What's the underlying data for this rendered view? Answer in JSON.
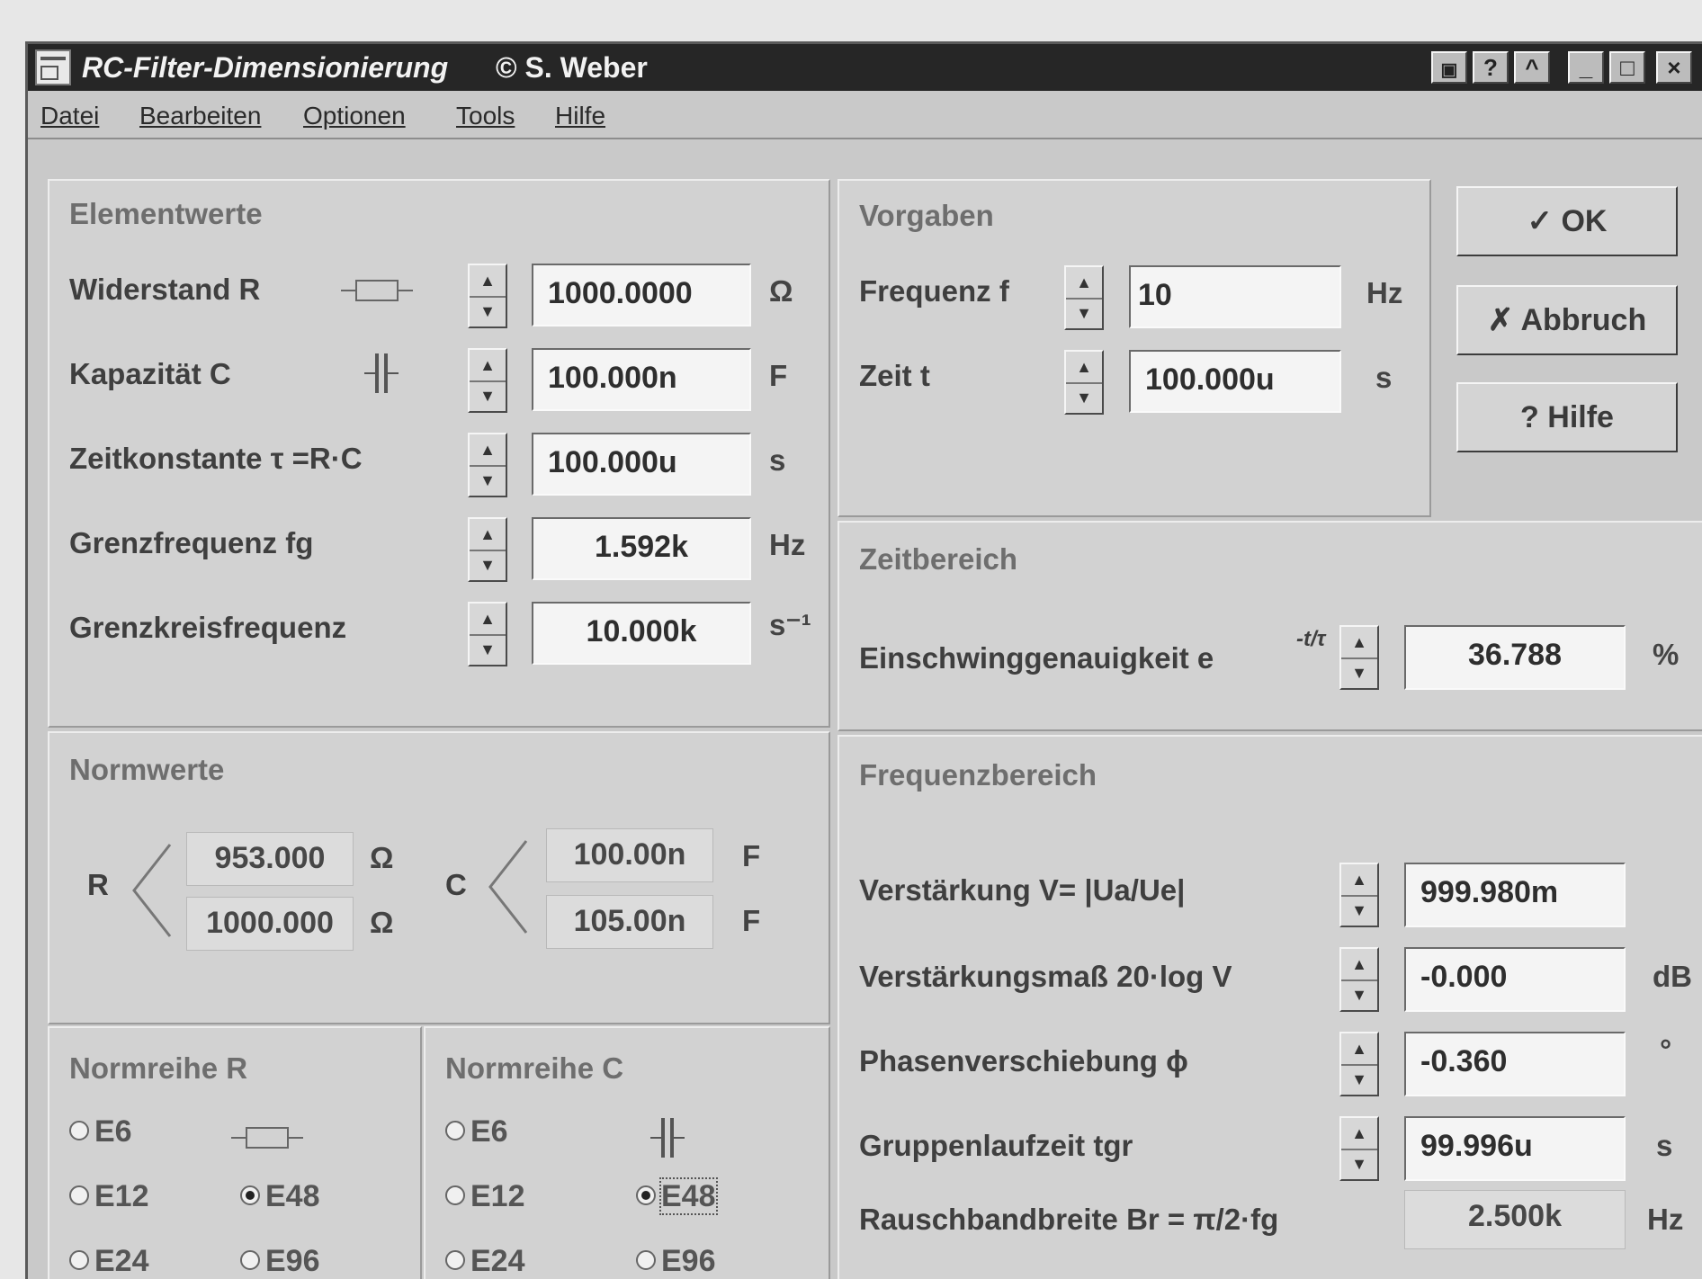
{
  "window": {
    "title": "RC-Filter-Dimensionierung",
    "copyright": "© S. Weber",
    "controls": [
      "?",
      "^",
      "_",
      "□",
      "×"
    ]
  },
  "menu": [
    "Datei",
    "Bearbeiten",
    "Optionen",
    "Tools",
    "Hilfe"
  ],
  "elementwerte": {
    "title": "Elementwerte",
    "rows": [
      {
        "label": "Widerstand R",
        "value": "1000.0000",
        "unit": "Ω"
      },
      {
        "label": "Kapazität C",
        "value": "100.000n",
        "unit": "F"
      },
      {
        "label": "Zeitkonstante τ =R·C",
        "value": "100.000u",
        "unit": "s"
      },
      {
        "label": "Grenzfrequenz fg",
        "value": "1.592k",
        "unit": "Hz"
      },
      {
        "label": "Grenzkreisfrequenz",
        "value": "10.000k",
        "unit": "s⁻¹"
      }
    ]
  },
  "vorgaben": {
    "title": "Vorgaben",
    "rows": [
      {
        "label": "Frequenz f",
        "value": "10",
        "unit": "Hz"
      },
      {
        "label": "Zeit t",
        "value": "100.000u",
        "unit": "s"
      }
    ]
  },
  "buttons": {
    "ok": "✓ OK",
    "cancel": "✗ Abbruch",
    "help": "? Hilfe"
  },
  "zeitbereich": {
    "title": "Zeitbereich",
    "label": "Einschwinggenauigkeit e",
    "exponent": "-t/τ",
    "value": "36.788",
    "unit": "%"
  },
  "normwerte": {
    "title": "Normwerte",
    "r_label": "R",
    "r_values": [
      "953.000",
      "1000.000"
    ],
    "r_unit": "Ω",
    "c_label": "C",
    "c_values": [
      "100.00n",
      "105.00n"
    ],
    "c_unit": "F"
  },
  "normreihe_r": {
    "title": "Normreihe R",
    "options": [
      "E6",
      "E12",
      "E24",
      "E48",
      "E96"
    ],
    "selected": "E48"
  },
  "normreihe_c": {
    "title": "Normreihe C",
    "options": [
      "E6",
      "E12",
      "E24",
      "E48",
      "E96"
    ],
    "selected": "E48"
  },
  "frequenzbereich": {
    "title": "Frequenzbereich",
    "rows": [
      {
        "label": "Verstärkung V= |Ua/Ue|",
        "value": "999.980m",
        "unit": ""
      },
      {
        "label": "Verstärkungsmaß 20·log V",
        "value": "-0.000",
        "unit": "dB"
      },
      {
        "label": "Phasenverschiebung ϕ",
        "value": "-0.360",
        "unit": "°"
      },
      {
        "label": "Gruppenlaufzeit tgr",
        "value": "99.996u",
        "unit": "s"
      }
    ],
    "rausch": {
      "label": "Rauschbandbreite Br = π/2·fg",
      "value": "2.500k",
      "unit": "Hz"
    }
  }
}
